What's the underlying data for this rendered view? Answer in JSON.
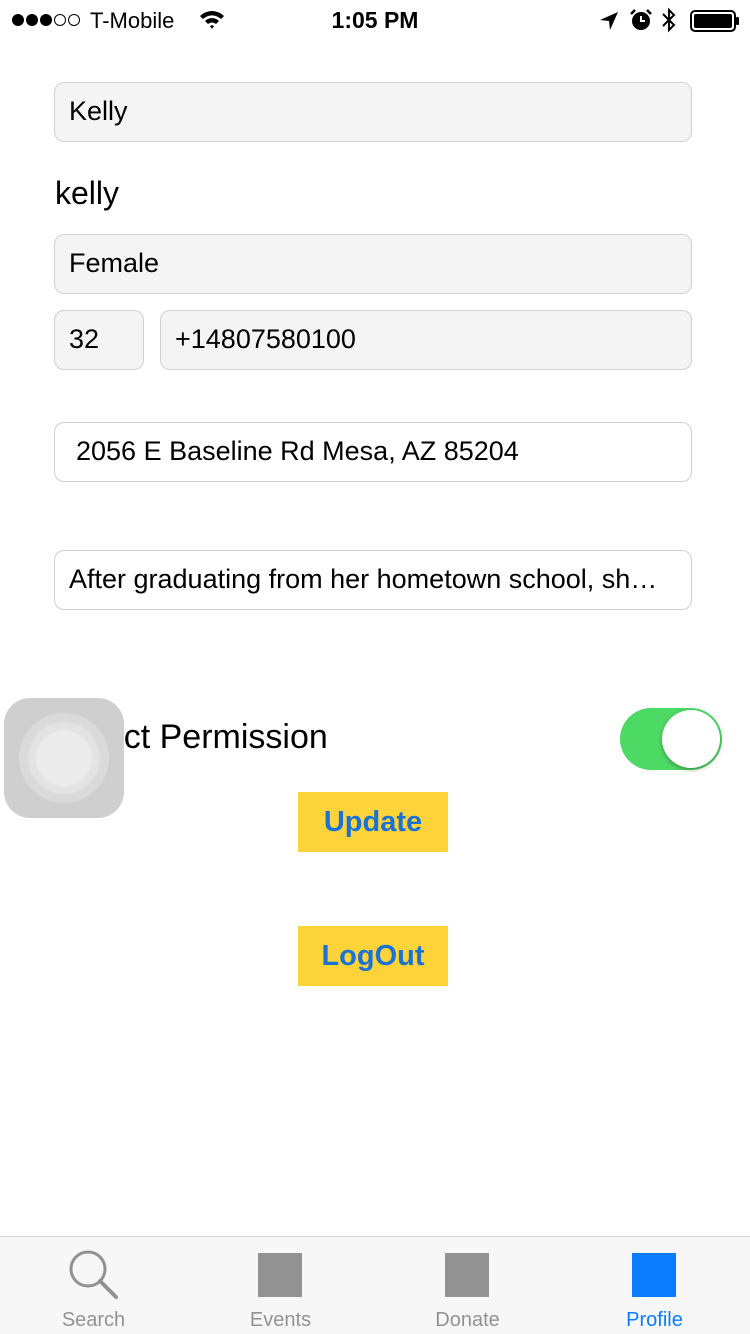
{
  "status_bar": {
    "carrier": "T-Mobile",
    "time": "1:05 PM",
    "signal_bars_filled": 3,
    "signal_bars_total": 5
  },
  "profile": {
    "first_name": "Kelly",
    "username": "kelly",
    "gender": "Female",
    "age": "32",
    "phone": "+14807580100",
    "address": "2056 E Baseline Rd Mesa, AZ 85204",
    "bio": "After graduating from her hometown school, she moved to Arizona to pursue her career"
  },
  "contact_permission": {
    "label": "Contact Permission",
    "enabled": true
  },
  "buttons": {
    "update": "Update",
    "logout": "LogOut"
  },
  "tabs": [
    {
      "label": "Search",
      "icon": "search-icon",
      "active": false
    },
    {
      "label": "Events",
      "icon": "events-icon",
      "active": false
    },
    {
      "label": "Donate",
      "icon": "donate-icon",
      "active": false
    },
    {
      "label": "Profile",
      "icon": "profile-icon",
      "active": true
    }
  ],
  "colors": {
    "accent": "#0a7cff",
    "button_bg": "#fdd33a",
    "button_text": "#1a72d6",
    "toggle_on": "#4cd964"
  }
}
